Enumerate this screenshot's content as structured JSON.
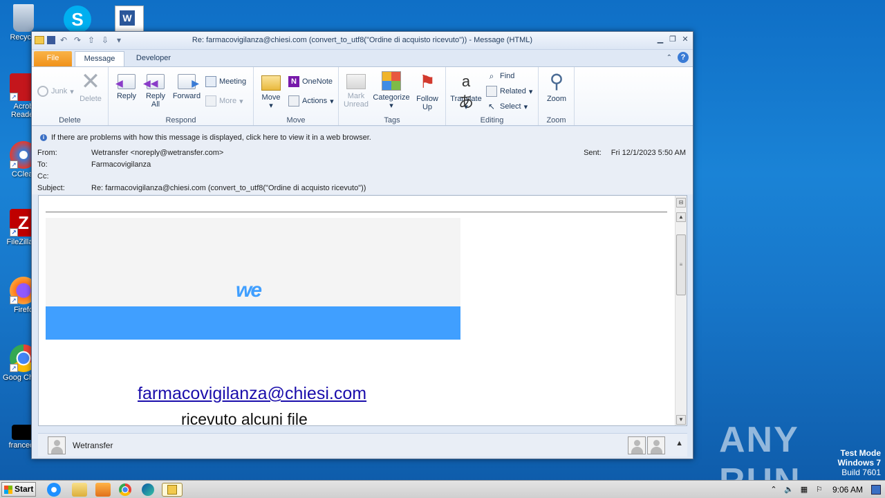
{
  "desktop": {
    "icons": [
      {
        "label": "Recycle",
        "color": "#9fb3c8"
      },
      {
        "label": "Acrob Reader",
        "color": "#c4161c"
      },
      {
        "label": "CClear",
        "color": "#3a7bd5"
      },
      {
        "label": "FileZilla C",
        "color": "#bf0000"
      },
      {
        "label": "Firefo",
        "color": "#ff7a1a"
      },
      {
        "label": "Goog Chron",
        "color": "#34a853"
      },
      {
        "label": "francede",
        "color": "#000000"
      }
    ]
  },
  "window": {
    "title": "Re: farmacovigilanza@chiesi.com (convert_to_utf8(\"Ordine di acquisto ricevuto\")) - Message (HTML)",
    "tabs": {
      "file": "File",
      "message": "Message",
      "developer": "Developer"
    },
    "ribbon": {
      "delete": {
        "label": "Delete",
        "junk": "Junk",
        "delete_btn": "Delete"
      },
      "respond": {
        "label": "Respond",
        "reply": "Reply",
        "reply_all_1": "Reply",
        "reply_all_2": "All",
        "forward": "Forward",
        "meeting": "Meeting",
        "more": "More"
      },
      "move": {
        "label": "Move",
        "move_btn": "Move",
        "onenote": "OneNote",
        "actions": "Actions"
      },
      "tags": {
        "label": "Tags",
        "mark_unread_1": "Mark",
        "mark_unread_2": "Unread",
        "categorize": "Categorize",
        "follow_up_1": "Follow",
        "follow_up_2": "Up"
      },
      "editing": {
        "label": "Editing",
        "translate": "Translate",
        "find": "Find",
        "related": "Related",
        "select": "Select"
      },
      "zoom": {
        "label": "Zoom",
        "zoom_btn": "Zoom"
      }
    },
    "header": {
      "infobar": "If there are problems with how this message is displayed, click here to view it in a web browser.",
      "from_label": "From:",
      "from_value": "Wetransfer <noreply@wetransfer.com>",
      "to_label": "To:",
      "to_value": "Farmacovigilanza",
      "cc_label": "Cc:",
      "subject_label": "Subject:",
      "subject_value": "Re: farmacovigilanza@chiesi.com (convert_to_utf8(\"Ordine di acquisto ricevuto\"))",
      "sent_label": "Sent:",
      "sent_value": "Fri 12/1/2023 5:50 AM"
    },
    "body": {
      "logo": "we",
      "email_link": "farmacovigilanza@chiesi.com",
      "received_text": "ricevuto alcuni file"
    },
    "people_pane": {
      "name": "Wetransfer"
    }
  },
  "watermark": "ANY RUN",
  "test_mode": {
    "line1": "Test Mode",
    "line2": "Windows 7",
    "line3": "Build 7601"
  },
  "taskbar": {
    "start": "Start",
    "clock": "9:06 AM"
  },
  "colors": {
    "wetransfer_blue": "#409fff",
    "file_tab": "#f0921a",
    "link": "#1a0dab"
  }
}
